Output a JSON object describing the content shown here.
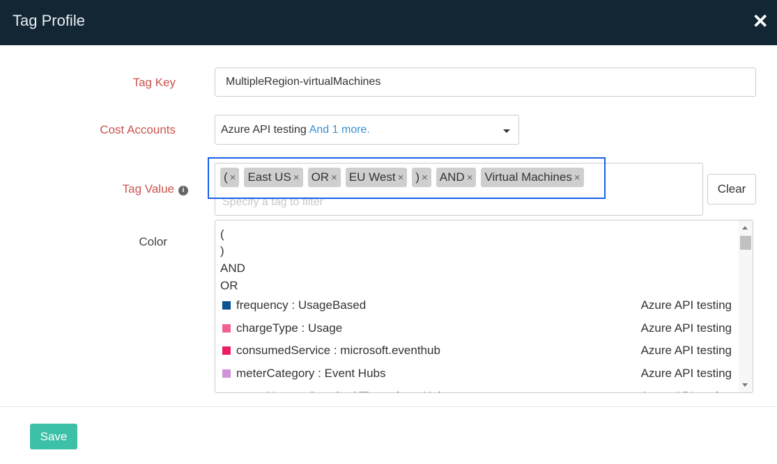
{
  "header": {
    "title": "Tag Profile",
    "close_icon": "close-icon"
  },
  "tag_key": {
    "label": "Tag Key",
    "value": "MultipleRegion-virtualMachines"
  },
  "cost_accounts": {
    "label": "Cost Accounts",
    "selected": "Azure API testing",
    "more": "And 1 more."
  },
  "tag_value": {
    "label": "Tag Value",
    "info_icon": "info-icon",
    "chips": [
      "(",
      "East US",
      "OR",
      "EU West",
      ")",
      "AND",
      "Virtual Machines"
    ],
    "chip_remove": "×",
    "placeholder": "Specify a tag to filter",
    "clear_label": "Clear"
  },
  "color": {
    "label": "Color",
    "operators": [
      "(",
      ")",
      "AND",
      "OR"
    ],
    "items": [
      {
        "tag": "frequency : UsageBased",
        "account": "Azure API testing",
        "color": "#0b5394"
      },
      {
        "tag": "chargeType : Usage",
        "account": "Azure API testing",
        "color": "#f06292"
      },
      {
        "tag": "consumedService : microsoft.eventhub",
        "account": "Azure API testing",
        "color": "#e91e63"
      },
      {
        "tag": "meterCategory : Event Hubs",
        "account": "Azure API testing",
        "color": "#ce93d8"
      },
      {
        "tag": "meterName : Standard Throughput Unit",
        "account": "Azure API testing",
        "color": "#5e35b1"
      }
    ]
  },
  "footer": {
    "save_label": "Save"
  },
  "colors": {
    "header_bg": "#132634",
    "label": "#c9534f",
    "save": "#3cc0a8",
    "highlight": "#1a5fe8",
    "link": "#3a8fcf"
  }
}
